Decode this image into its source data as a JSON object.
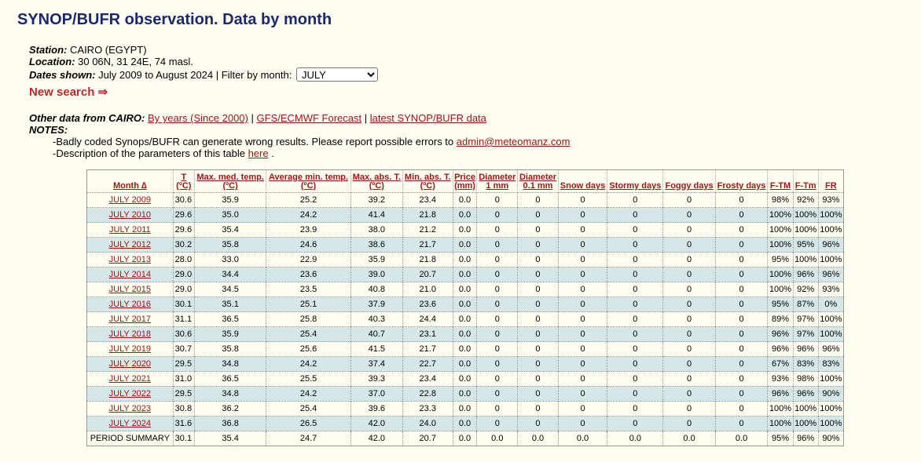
{
  "page": {
    "title": "SYNOP/BUFR observation. Data by month"
  },
  "station": {
    "station_label": "Station:",
    "station_value": "CAIRO (EGYPT)",
    "location_label": "Location:",
    "location_value": "30 06N, 31 24E, 74 masl.",
    "dates_label": "Dates shown:",
    "dates_value": "July 2009 to August 2024 | Filter by month:",
    "month_selected": "JULY"
  },
  "new_search": "New search ⇒",
  "other": {
    "label": "Other data from CAIRO:",
    "link1": "By years (Since 2000)",
    "sep": "|",
    "link2": "GFS/ECMWF Forecast",
    "link3": "latest SYNOP/BUFR data",
    "notes_label": "NOTES:",
    "note1": "-Badly coded Synops/BUFR can generate wrong results. Please report possible errors to",
    "email": "admin@meteomanz.com",
    "note2_pre": "-Description of the parameters of this table",
    "note2_link": "here",
    "note2_post": "."
  },
  "table": {
    "headers": [
      [
        "Month ∆",
        ""
      ],
      [
        "T",
        "(ºC)"
      ],
      [
        "Max. med. temp.",
        "(ºC)"
      ],
      [
        "Average min. temp.",
        "(ºC)"
      ],
      [
        "Max. abs. T.",
        "(ºC)"
      ],
      [
        "Min. abs. T.",
        "(ºC)"
      ],
      [
        "Price",
        "(mm)"
      ],
      [
        "Diameter",
        "1 mm"
      ],
      [
        "Diameter",
        "0.1 mm"
      ],
      [
        "Snow days",
        ""
      ],
      [
        "Stormy days",
        ""
      ],
      [
        "Foggy days",
        ""
      ],
      [
        "Frosty days",
        ""
      ],
      [
        "F-TM",
        ""
      ],
      [
        "F-Tm",
        ""
      ],
      [
        "FR",
        ""
      ]
    ],
    "rows": [
      [
        "JULY 2009",
        "30.6",
        "35.9",
        "25.2",
        "39.2",
        "23.4",
        "0.0",
        "0",
        "0",
        "0",
        "0",
        "0",
        "0",
        "98%",
        "92%",
        "93%"
      ],
      [
        "JULY 2010",
        "29.6",
        "35.0",
        "24.2",
        "41.4",
        "21.8",
        "0.0",
        "0",
        "0",
        "0",
        "0",
        "0",
        "0",
        "100%",
        "100%",
        "100%"
      ],
      [
        "JULY 2011",
        "29.6",
        "35.4",
        "23.9",
        "38.0",
        "21.2",
        "0.0",
        "0",
        "0",
        "0",
        "0",
        "0",
        "0",
        "100%",
        "100%",
        "100%"
      ],
      [
        "JULY 2012",
        "30.2",
        "35.8",
        "24.6",
        "38.6",
        "21.7",
        "0.0",
        "0",
        "0",
        "0",
        "0",
        "0",
        "0",
        "100%",
        "95%",
        "96%"
      ],
      [
        "JULY 2013",
        "28.0",
        "33.0",
        "22.9",
        "35.9",
        "21.8",
        "0.0",
        "0",
        "0",
        "0",
        "0",
        "0",
        "0",
        "95%",
        "100%",
        "100%"
      ],
      [
        "JULY 2014",
        "29.0",
        "34.4",
        "23.6",
        "39.0",
        "20.7",
        "0.0",
        "0",
        "0",
        "0",
        "0",
        "0",
        "0",
        "100%",
        "96%",
        "96%"
      ],
      [
        "JULY 2015",
        "29.0",
        "34.5",
        "23.5",
        "40.8",
        "21.0",
        "0.0",
        "0",
        "0",
        "0",
        "0",
        "0",
        "0",
        "100%",
        "92%",
        "93%"
      ],
      [
        "JULY 2016",
        "30.1",
        "35.1",
        "25.1",
        "37.9",
        "23.6",
        "0.0",
        "0",
        "0",
        "0",
        "0",
        "0",
        "0",
        "95%",
        "87%",
        "0%"
      ],
      [
        "JULY 2017",
        "31.1",
        "36.5",
        "25.8",
        "40.3",
        "24.4",
        "0.0",
        "0",
        "0",
        "0",
        "0",
        "0",
        "0",
        "89%",
        "97%",
        "100%"
      ],
      [
        "JULY 2018",
        "30.6",
        "35.9",
        "25.4",
        "40.7",
        "23.1",
        "0.0",
        "0",
        "0",
        "0",
        "0",
        "0",
        "0",
        "96%",
        "97%",
        "100%"
      ],
      [
        "JULY 2019",
        "30.7",
        "35.8",
        "25.6",
        "41.5",
        "21.7",
        "0.0",
        "0",
        "0",
        "0",
        "0",
        "0",
        "0",
        "96%",
        "96%",
        "96%"
      ],
      [
        "JULY 2020",
        "29.5",
        "34.8",
        "24.2",
        "37.4",
        "22.7",
        "0.0",
        "0",
        "0",
        "0",
        "0",
        "0",
        "0",
        "67%",
        "83%",
        "83%"
      ],
      [
        "JULY 2021",
        "31.0",
        "36.5",
        "25.5",
        "39.3",
        "23.4",
        "0.0",
        "0",
        "0",
        "0",
        "0",
        "0",
        "0",
        "93%",
        "98%",
        "100%"
      ],
      [
        "JULY 2022",
        "29.5",
        "34.8",
        "24.2",
        "37.0",
        "22.8",
        "0.0",
        "0",
        "0",
        "0",
        "0",
        "0",
        "0",
        "96%",
        "96%",
        "90%"
      ],
      [
        "JULY 2023",
        "30.8",
        "36.2",
        "25.4",
        "39.6",
        "23.3",
        "0.0",
        "0",
        "0",
        "0",
        "0",
        "0",
        "0",
        "100%",
        "100%",
        "100%"
      ],
      [
        "JULY 2024",
        "31.6",
        "36.8",
        "26.5",
        "42.0",
        "24.0",
        "0.0",
        "0",
        "0",
        "0",
        "0",
        "0",
        "0",
        "100%",
        "100%",
        "100%"
      ]
    ],
    "summary": [
      "PERIOD SUMMARY",
      "30.1",
      "35.4",
      "24.7",
      "42.0",
      "20.7",
      "0.0",
      "0.0",
      "0.0",
      "0.0",
      "0.0",
      "0.0",
      "0.0",
      "95%",
      "96%",
      "90%"
    ]
  },
  "colors": {
    "title": "#1a2a6c",
    "link": "#a31515",
    "row_alt": "#d6e7e7",
    "background": "#fffdf0"
  }
}
